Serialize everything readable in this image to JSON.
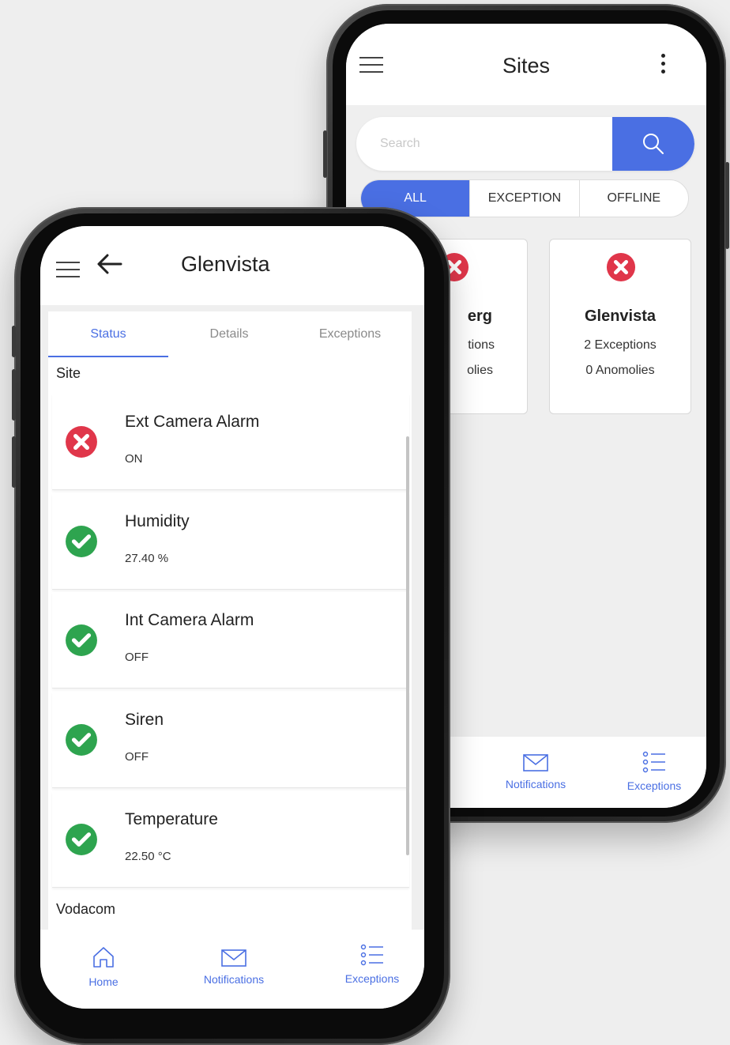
{
  "back_screen": {
    "title": "Sites",
    "search": {
      "placeholder": "Search",
      "value": ""
    },
    "filters": [
      {
        "label": "ALL",
        "active": true
      },
      {
        "label": "EXCEPTION",
        "active": false
      },
      {
        "label": "OFFLINE",
        "active": false
      }
    ],
    "cards": [
      {
        "name": "erg",
        "line1": "tions",
        "line2": "olies",
        "status": "error"
      },
      {
        "name": "Glenvista",
        "line1": "2 Exceptions",
        "line2": "0 Anomolies",
        "status": "error"
      }
    ],
    "bottom_nav": [
      {
        "label": "Notifications",
        "icon": "envelope-icon"
      },
      {
        "label": "Exceptions",
        "icon": "list-icon"
      }
    ]
  },
  "front_screen": {
    "title": "Glenvista",
    "tabs": [
      {
        "label": "Status",
        "active": true
      },
      {
        "label": "Details",
        "active": false
      },
      {
        "label": "Exceptions",
        "active": false
      }
    ],
    "section_site": "Site",
    "items": [
      {
        "label": "Ext Camera Alarm",
        "value": "ON",
        "status": "error"
      },
      {
        "label": "Humidity",
        "value": "27.40 %",
        "status": "ok"
      },
      {
        "label": "Int Camera Alarm",
        "value": "OFF",
        "status": "ok"
      },
      {
        "label": "Siren",
        "value": "OFF",
        "status": "ok"
      },
      {
        "label": "Temperature",
        "value": "22.50 °C",
        "status": "ok"
      }
    ],
    "section_vodacom": "Vodacom",
    "bottom_nav": [
      {
        "label": "Home",
        "icon": "home-icon"
      },
      {
        "label": "Notifications",
        "icon": "envelope-icon"
      },
      {
        "label": "Exceptions",
        "icon": "list-icon"
      }
    ]
  },
  "colors": {
    "accent": "#4a6fe3",
    "error": "#e0364a",
    "ok": "#2ea44f"
  }
}
